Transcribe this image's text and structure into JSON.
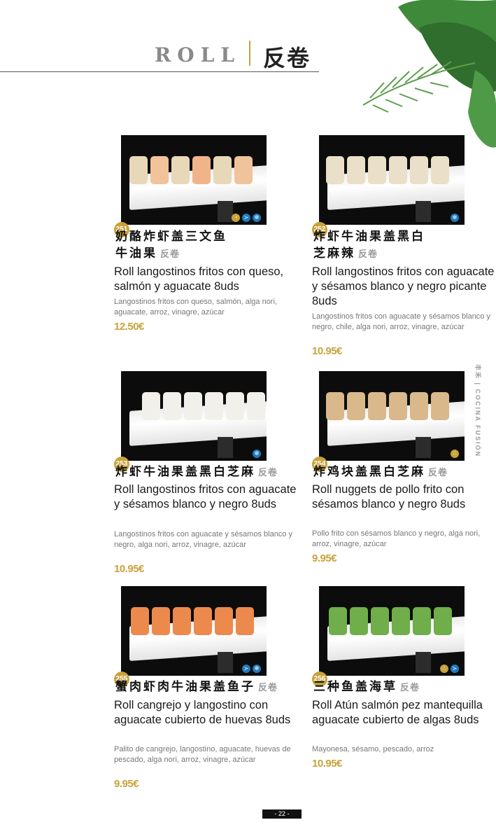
{
  "header": {
    "roll": "ROLL",
    "title_zh": "反卷"
  },
  "side_text": "丰禾 | COCINA FUSIÓN",
  "page_number": "- 22 -",
  "colors": {
    "gold": "#c9a23a",
    "badge_blue": "#1e7bbf",
    "photo_bg": "#0c0c0c"
  },
  "items": [
    {
      "num": "251",
      "zh_line1": "奶酪炸虾盖三文鱼",
      "zh_line2": "牛油果",
      "tag": "反卷",
      "es_name": "Roll langostinos fritos con queso, salmón y aguacate 8uds",
      "desc": "Langostinos fritos con queso, salmón, alga nori, aguacate, arroz, vinagre, azúcar",
      "price": "12.50€",
      "icons": [
        "milk-icon",
        "fish-icon",
        "crustacean-icon"
      ]
    },
    {
      "num": "252",
      "zh_line1": "炸虾牛油果盖黑白",
      "zh_line2": "芝麻辣",
      "tag": "反卷",
      "es_name": "Roll langostinos fritos con aguacate y sésamos blanco y negro picante 8uds",
      "desc": "Langostinos fritos con aguacate y sésamos blanco y negro, chile, alga nori, arroz, vinagre, azúcar",
      "price": "10.95€",
      "icons": [
        "crustacean-icon"
      ]
    },
    {
      "num": "253",
      "zh_line1": "炸虾牛油果盖黑白芝麻",
      "zh_line2": "",
      "tag": "反卷",
      "es_name": "Roll langostinos fritos con aguacate y sésamos blanco y negro 8uds",
      "desc": "Langostinos fritos con aguacate y sésamos blanco y negro, alga nori, arroz, vinagre, azúcar",
      "price": "10.95€",
      "icons": [
        "crustacean-icon"
      ]
    },
    {
      "num": "254",
      "zh_line1": "炸鸡块盖黑白芝麻",
      "zh_line2": "",
      "tag": "反卷",
      "es_name": "Roll nuggets de pollo frito con sésamos blanco y negro 8uds",
      "desc": "Pollo frito con sésamos blanco y negro, alga nori, arroz, vinagre, azúcar",
      "price": "9.95€",
      "icons": [
        "sesame-icon"
      ]
    },
    {
      "num": "255",
      "zh_line1": "蟹肉虾肉牛油果盖鱼子",
      "zh_line2": "",
      "tag": "反卷",
      "es_name": "Roll cangrejo y langostino con aguacate cubierto de huevas 8uds",
      "desc": "Palito de cangrejo, langostino, aguacate, huevas de pescado, alga nori, arroz, vinagre, azúcar",
      "price": "9.95€",
      "icons": [
        "fish-icon",
        "crustacean-icon"
      ]
    },
    {
      "num": "256",
      "zh_line1": "三种鱼盖海草",
      "zh_line2": "",
      "tag": "反卷",
      "es_name": "Roll Atún salmón pez mantequilla aguacate cubierto de algas 8uds",
      "desc": "Mayonesa, sésamo, pescado, arroz",
      "price": "10.95€",
      "icons": [
        "sesame-icon",
        "fish-icon"
      ]
    }
  ]
}
